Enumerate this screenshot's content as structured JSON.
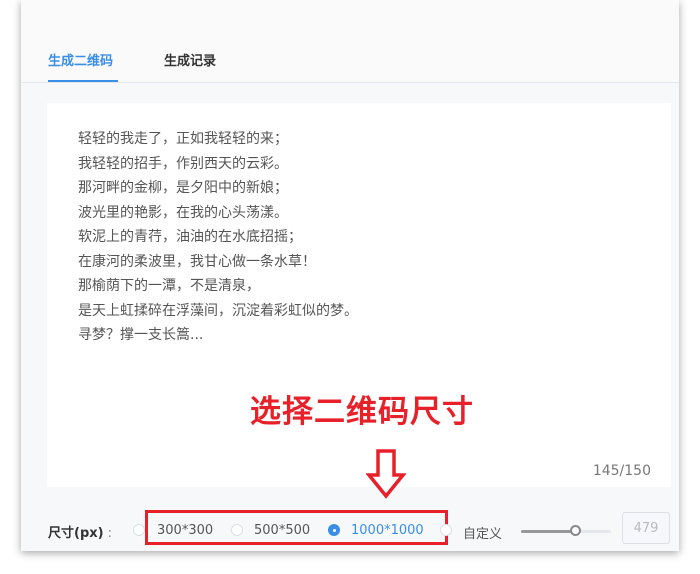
{
  "tabs": [
    {
      "label": "生成二维码",
      "active": true
    },
    {
      "label": "生成记录",
      "active": false
    }
  ],
  "poem": "轻轻的我走了，正如我轻轻的来；\n我轻轻的招手，作别西天的云彩。\n那河畔的金柳，是夕阳中的新娘；\n波光里的艳影，在我的心头荡漾。\n软泥上的青荇，油油的在水底招摇；\n在康河的柔波里，我甘心做一条水草！\n那榆荫下的一潭，不是清泉，\n是天上虹揉碎在浮藻间，沉淀着彩虹似的梦。\n寻梦？撑一支长篙...",
  "char_count": "145/150",
  "annotation": "选择二维码尺寸",
  "size": {
    "label": "尺寸(px)",
    "colon": ":",
    "options": [
      {
        "label": "300*300",
        "selected": false
      },
      {
        "label": "500*500",
        "selected": false
      },
      {
        "label": "1000*1000",
        "selected": true
      },
      {
        "label": "自定义",
        "selected": false
      }
    ],
    "slider_fraction": 0.6,
    "custom_value": "479"
  },
  "colors": {
    "accent": "#3a8ee6",
    "annotation": "#e8202a"
  }
}
